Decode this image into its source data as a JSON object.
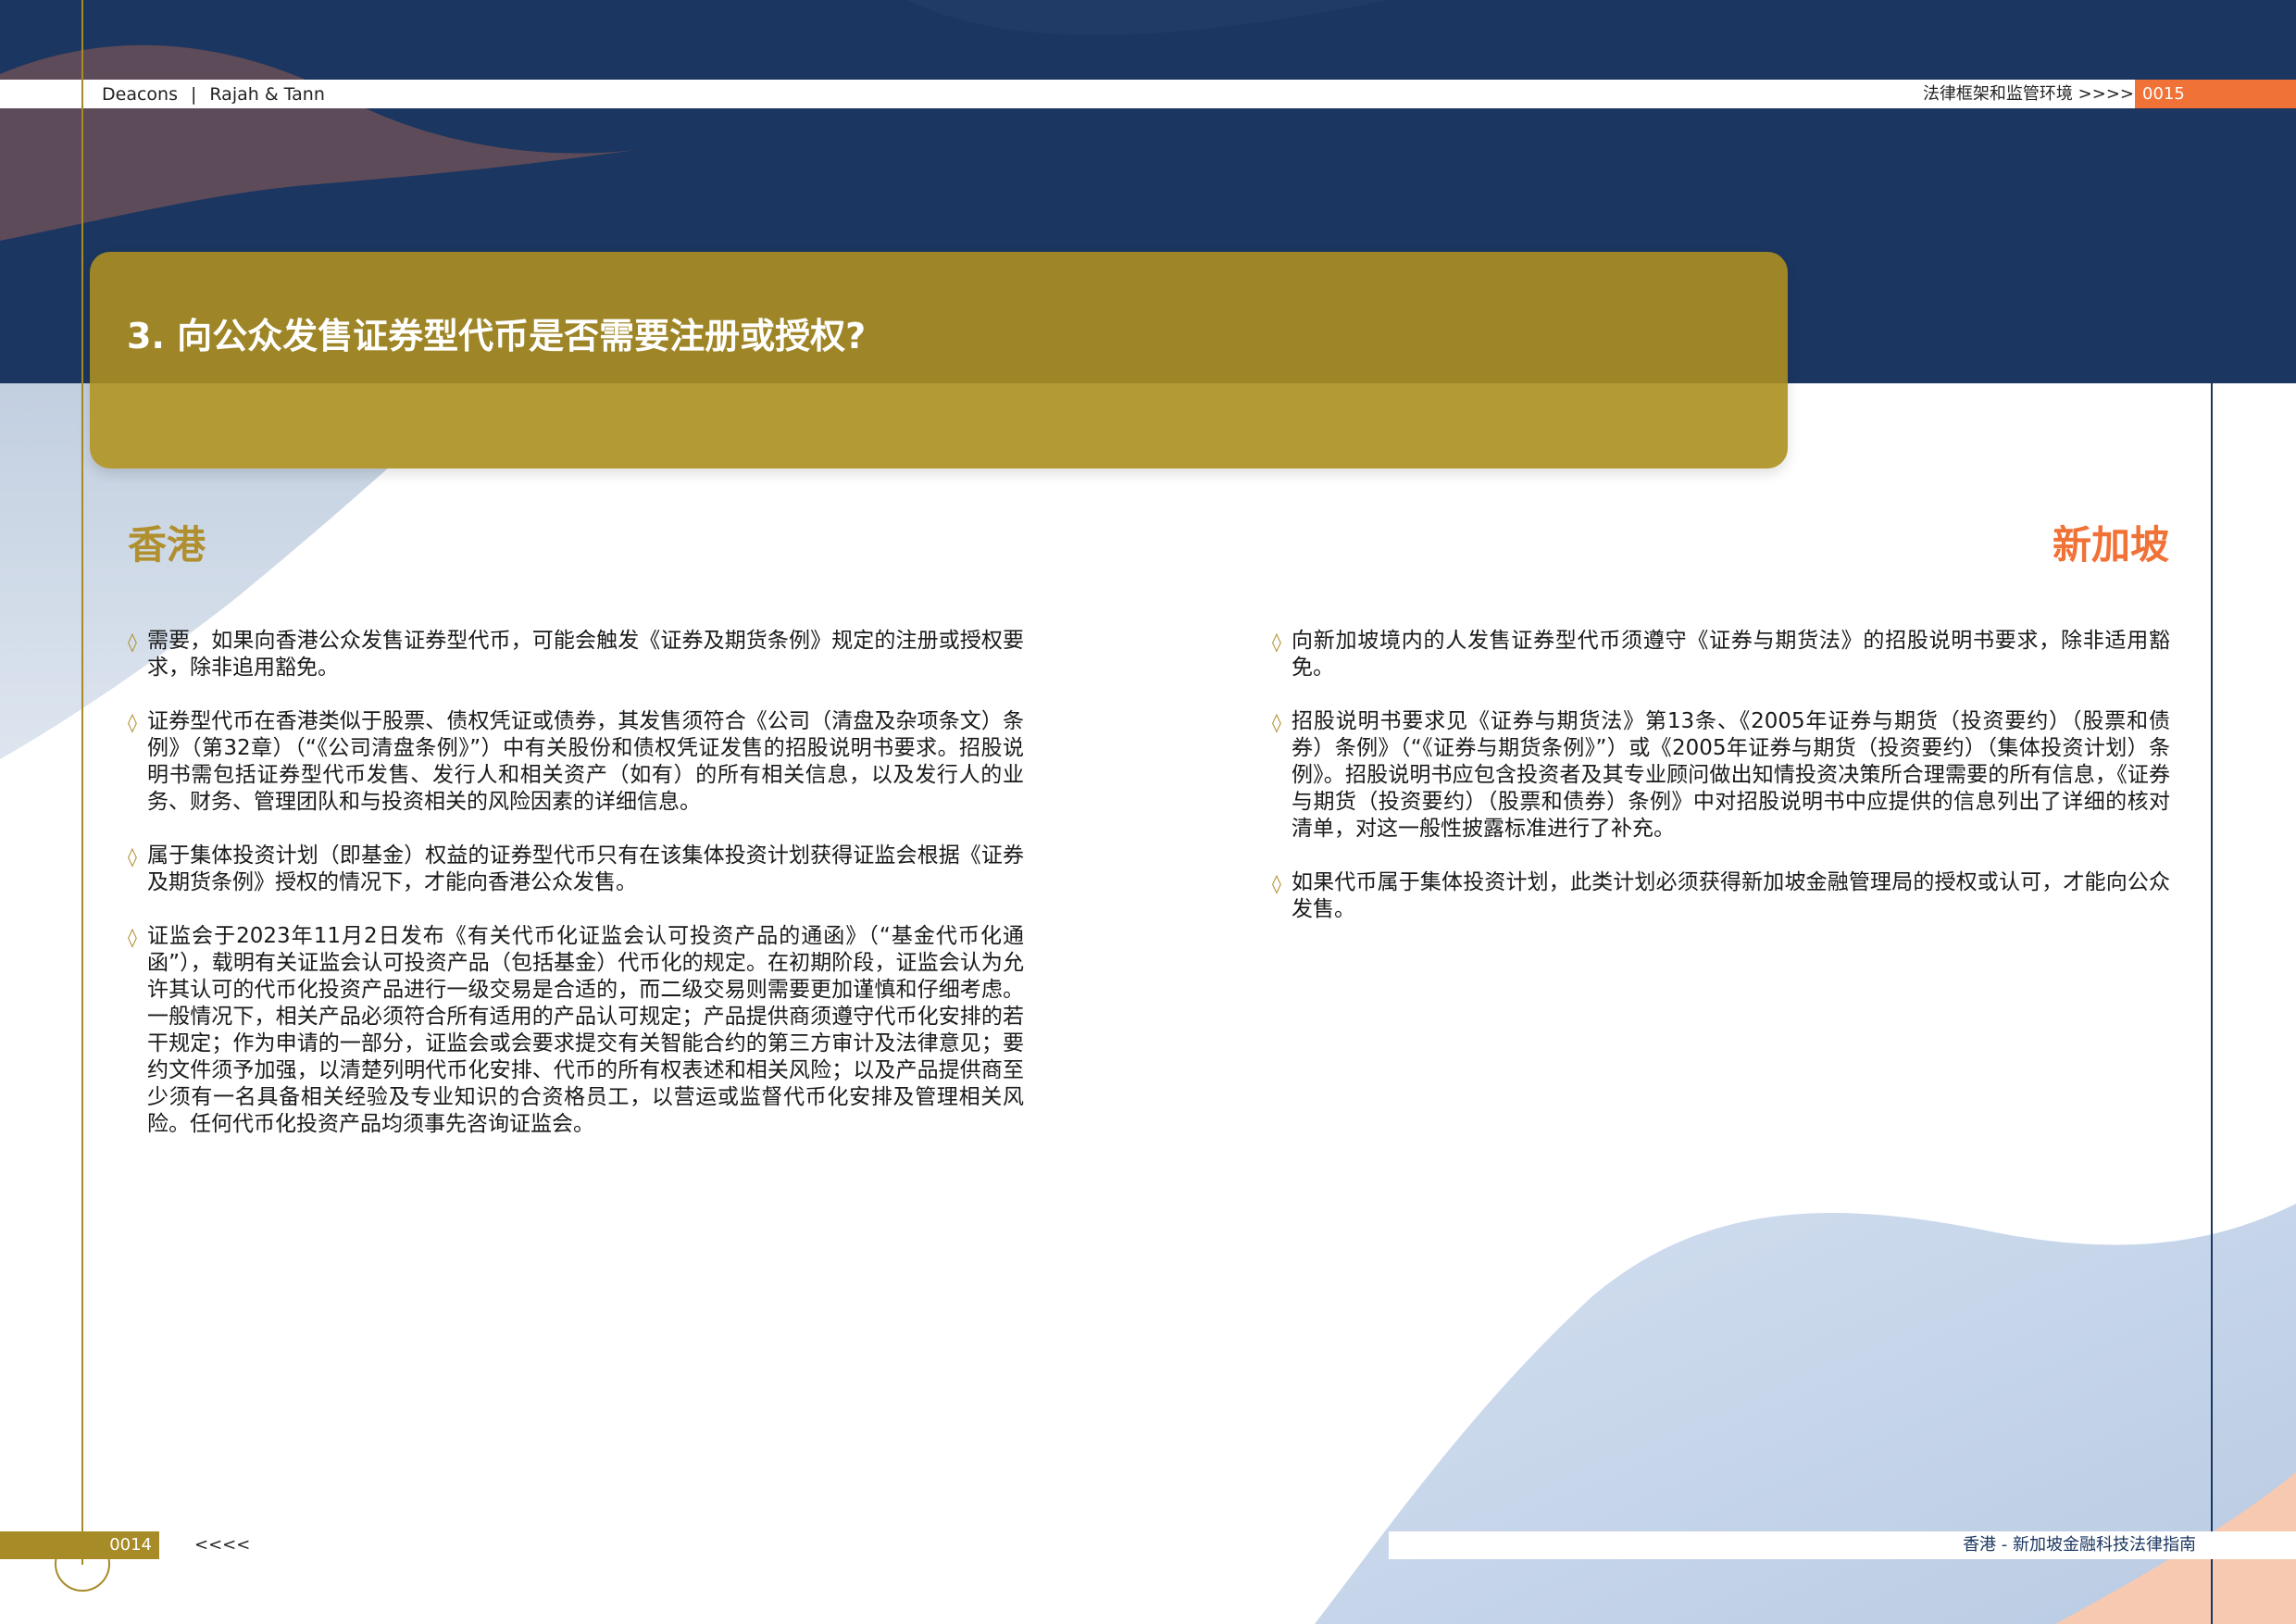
{
  "header": {
    "brand_left": "Deacons",
    "brand_separator": "|",
    "brand_right": "Rajah & Tann",
    "section_nav": "法律框架和监管环境 >>>>",
    "page_number_right": "0015"
  },
  "question": {
    "title": "3. 向公众发售证券型代币是否需要注册或授权?"
  },
  "hong_kong": {
    "heading": "香港",
    "items": [
      "需要，如果向香港公众发售证券型代币，可能会触发《证券及期货条例》规定的注册或授权要求，除非追用豁免。",
      "证券型代币在香港类似于股票、债权凭证或债券，其发售须符合《公司（清盘及杂项条文）条例》（第32章）（“《公司清盘条例》”）中有关股份和债权凭证发售的招股说明书要求。招股说明书需包括证券型代币发售、发行人和相关资产（如有）的所有相关信息，以及发行人的业务、财务、管理团队和与投资相关的风险因素的详细信息。",
      "属于集体投资计划（即基金）权益的证券型代币只有在该集体投资计划获得证监会根据《证券及期货条例》授权的情况下，才能向香港公众发售。",
      "证监会于2023年11月2日发布《有关代币化证监会认可投资产品的通函》（“基金代币化通函”），载明有关证监会认可投资产品（包括基金）代币化的规定。在初期阶段，证监会认为允许其认可的代币化投资产品进行一级交易是合适的，而二级交易则需要更加谨慎和仔细考虑。一般情况下，相关产品必须符合所有适用的产品认可规定；产品提供商须遵守代币化安排的若干规定；作为申请的一部分，证监会或会要求提交有关智能合约的第三方审计及法律意见；要约文件须予加强，以清楚列明代币化安排、代币的所有权表述和相关风险；以及产品提供商至少须有一名具备相关经验及专业知识的合资格员工，以营运或监督代币化安排及管理相关风险。任何代币化投资产品均须事先咨询证监会。"
    ]
  },
  "singapore": {
    "heading": "新加坡",
    "items": [
      "向新加坡境内的人发售证券型代币须遵守《证券与期货法》的招股说明书要求，除非适用豁免。",
      "招股说明书要求见《证券与期货法》第13条、《2005年证券与期货（投资要约）（股票和债券）条例》（“《证券与期货条例》”）或《2005年证券与期货（投资要约）（集体投资计划）条例》。招股说明书应包含投资者及其专业顾问做出知情投资决策所合理需要的所有信息，《证券与期货（投资要约）（股票和债券）条例》中对招股说明书中应提供的信息列出了详细的核对清单，对这一般性披露标准进行了补充。",
      "如果代币属于集体投资计划，此类计划必须获得新加坡金融管理局的授权或认可，才能向公众发售。"
    ]
  },
  "footer": {
    "page_number_left": "0014",
    "back_arrows": "<<<<",
    "guide_title": "香港 - 新加坡金融科技法律指南"
  },
  "colors": {
    "navy": "#1b3660",
    "gold": "#a78b26",
    "gold_heading": "#b08f2e",
    "orange": "#f07236",
    "light_blue": "#c5d3e8",
    "peach": "#f8c9b1"
  },
  "icons": {
    "bullet": "diamond-outline-icon",
    "bullet_glyph": "◊"
  }
}
